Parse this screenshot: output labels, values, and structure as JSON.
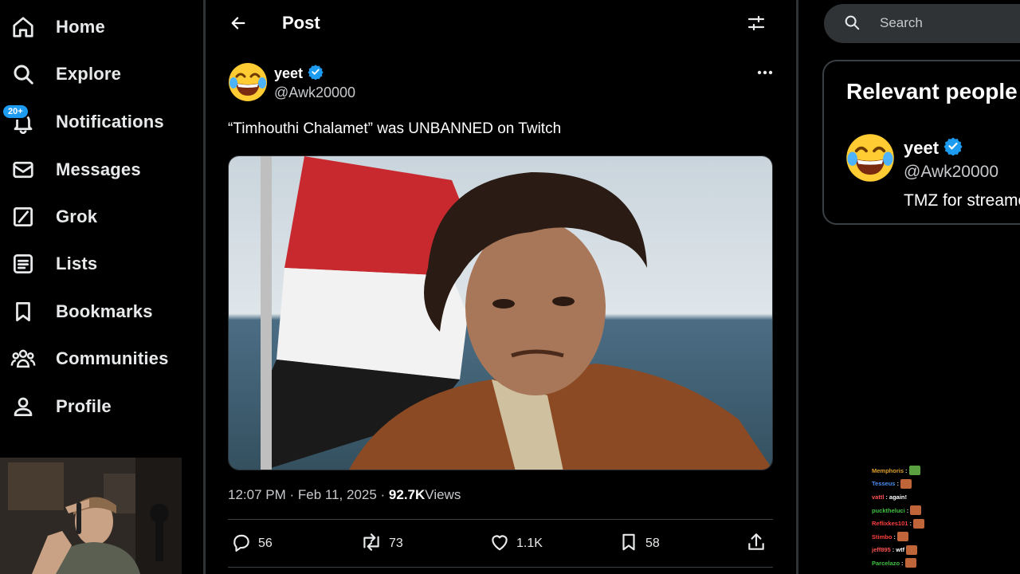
{
  "sidebar": {
    "items": [
      {
        "label": "Home",
        "icon": "home-icon"
      },
      {
        "label": "Explore",
        "icon": "search-icon"
      },
      {
        "label": "Notifications",
        "icon": "bell-icon",
        "badge": "20+"
      },
      {
        "label": "Messages",
        "icon": "envelope-icon"
      },
      {
        "label": "Grok",
        "icon": "grok-icon"
      },
      {
        "label": "Lists",
        "icon": "list-icon"
      },
      {
        "label": "Bookmarks",
        "icon": "bookmark-icon"
      },
      {
        "label": "Communities",
        "icon": "people-icon"
      },
      {
        "label": "Profile",
        "icon": "person-icon"
      }
    ]
  },
  "header": {
    "title": "Post"
  },
  "post": {
    "author": {
      "name": "yeet",
      "handle": "@Awk20000",
      "verified": true
    },
    "text": "“Timhouthi Chalamet” was UNBANNED on Twitch",
    "meta": {
      "time": "12:07 PM",
      "date": "Feb 11, 2025",
      "views_count": "92.7K",
      "views_label": " Views"
    },
    "actions": {
      "replies": "56",
      "reposts": "73",
      "likes": "1.1K",
      "bookmarks": "58"
    }
  },
  "search": {
    "placeholder": "Search"
  },
  "relevant": {
    "title": "Relevant people",
    "person": {
      "name": "yeet",
      "handle": "@Awk20000",
      "bio": "TMZ for streamers"
    }
  },
  "chat": {
    "lines": [
      {
        "user": "Memphoris",
        "color": "#e0a030",
        "msg": "",
        "emote": true
      },
      {
        "user": "Tesseus",
        "color": "#4a8ff0",
        "msg": "",
        "emote": true
      },
      {
        "user": "vattl",
        "color": "#ff5050",
        "msg": "again!",
        "emote": false
      },
      {
        "user": "pucktheluci",
        "color": "#40c040",
        "msg": "",
        "emote": true
      },
      {
        "user": "Reflixkes101",
        "color": "#ff4040",
        "msg": "",
        "emote": true
      },
      {
        "user": "Stimbo",
        "color": "#ff4040",
        "msg": "",
        "emote": true
      },
      {
        "user": "jeff895",
        "color": "#ff5050",
        "msg": "wtf",
        "emote": true
      },
      {
        "user": "Parcelazo",
        "color": "#40c040",
        "msg": "",
        "emote": true
      }
    ]
  },
  "colors": {
    "accent": "#1d9bf0",
    "background": "#000000",
    "border": "#2f3336"
  }
}
